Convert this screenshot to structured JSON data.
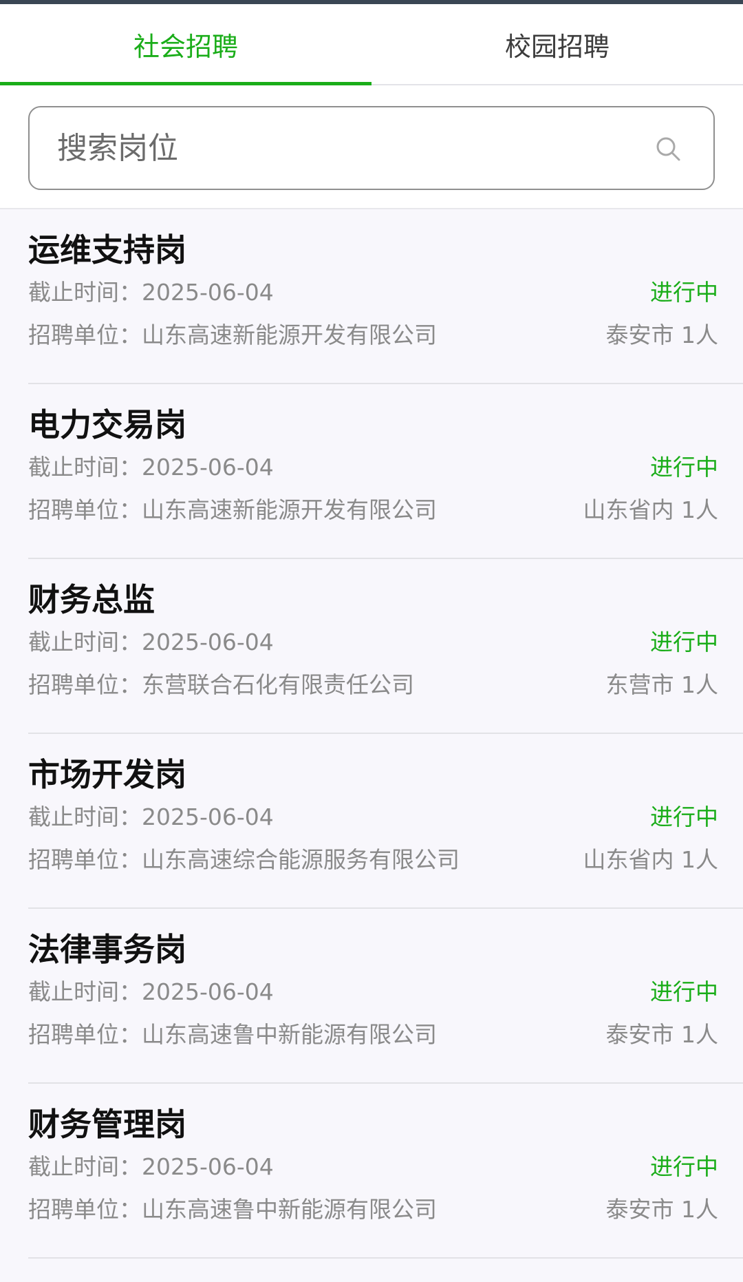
{
  "tabs": [
    {
      "label": "社会招聘",
      "active": true
    },
    {
      "label": "校园招聘",
      "active": false
    }
  ],
  "search": {
    "placeholder": "搜索岗位",
    "icon": "search-icon"
  },
  "colors": {
    "accent": "#1aad19",
    "muted_text": "#8a8a8a",
    "title_text": "#111111",
    "background": "#f8f7fc"
  },
  "jobs": [
    {
      "title": "运维支持岗",
      "deadline": "截止时间：2025-06-04",
      "status": "进行中",
      "company": "招聘单位：山东高速新能源开发有限公司",
      "location": "泰安市 1人"
    },
    {
      "title": "电力交易岗",
      "deadline": "截止时间：2025-06-04",
      "status": "进行中",
      "company": "招聘单位：山东高速新能源开发有限公司",
      "location": "山东省内 1人"
    },
    {
      "title": "财务总监",
      "deadline": "截止时间：2025-06-04",
      "status": "进行中",
      "company": "招聘单位：东营联合石化有限责任公司",
      "location": "东营市 1人"
    },
    {
      "title": "市场开发岗",
      "deadline": "截止时间：2025-06-04",
      "status": "进行中",
      "company": "招聘单位：山东高速综合能源服务有限公司",
      "location": "山东省内 1人"
    },
    {
      "title": "法律事务岗",
      "deadline": "截止时间：2025-06-04",
      "status": "进行中",
      "company": "招聘单位：山东高速鲁中新能源有限公司",
      "location": "泰安市 1人"
    },
    {
      "title": "财务管理岗",
      "deadline": "截止时间：2025-06-04",
      "status": "进行中",
      "company": "招聘单位：山东高速鲁中新能源有限公司",
      "location": "泰安市 1人"
    }
  ]
}
